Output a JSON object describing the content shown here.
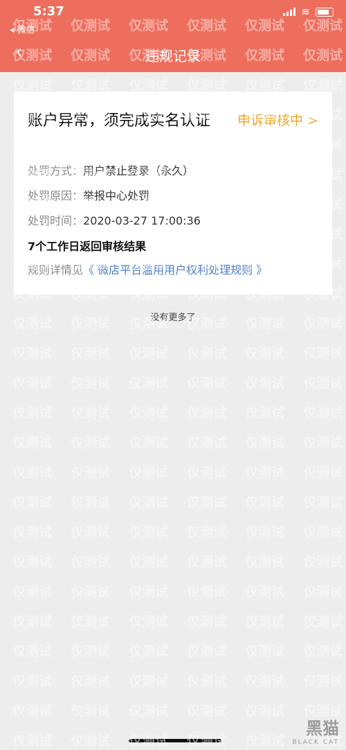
{
  "status_bar": {
    "time": "5:37",
    "back_app": "◂ 微信"
  },
  "nav": {
    "back_symbol": "‹",
    "title": "违规记录"
  },
  "card": {
    "title": "账户异常，须完成实名认证",
    "status": "申诉审核中 >",
    "rows": [
      {
        "key": "处罚方式：",
        "value": "用户禁止登录（永久）"
      },
      {
        "key": "处罚原因：",
        "value": "举报中心处罚"
      },
      {
        "key": "处罚时间：",
        "value": "2020-03-27 17:00:36"
      }
    ],
    "result_note": "7个工作日返回审核结果",
    "rule_prefix": "规则详情见",
    "rule_link": "《 微店平台滥用用户权利处理规则 》"
  },
  "footer": {
    "no_more": "没有更多了"
  },
  "watermark": {
    "text": "仅测试"
  },
  "logo": {
    "mark": "黑猫",
    "sub": "BLACK CAT"
  },
  "colors": {
    "header": "#ee6e5d",
    "status": "#f0a21f",
    "link": "#4a7cc7",
    "background": "#ededed"
  }
}
